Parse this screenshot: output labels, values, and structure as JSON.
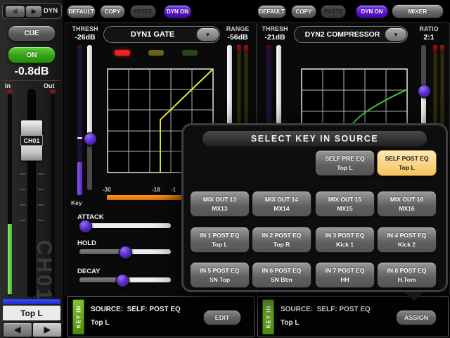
{
  "strip": {
    "nav_label": "DYN",
    "cue": "CUE",
    "on": "ON",
    "level": "-0.8dB",
    "in_label": "In",
    "out_label": "Out",
    "fader_cap": "CH01",
    "watermark": "CH01",
    "channel_name": "Top L"
  },
  "icons": {
    "left_arrow": "◀",
    "right_arrow": "▶",
    "dropdown_arrow": "▼"
  },
  "toolbar1": {
    "default": "DEFAULT",
    "copy": "COPY",
    "paste": "PASTE",
    "dyn_on": "DYN ON"
  },
  "toolbar2": {
    "default": "DEFAULT",
    "copy": "COPY",
    "paste": "PASTE",
    "dyn_on": "DYN ON",
    "mixer": "MIXER"
  },
  "dyn1": {
    "thresh_label": "THRESH",
    "thresh_value": "-26dB",
    "type": "DYN1 GATE",
    "range_label": "RANGE",
    "range_value": "-56dB",
    "key_label": "Key",
    "scale": {
      "t1": "-30",
      "t2": "-18",
      "t3": "-1"
    },
    "attack_label": "ATTACK",
    "hold_label": "HOLD",
    "decay_label": "DECAY",
    "keyin": {
      "tag": "KEY IN",
      "source": "SOURCE:  SELF: POST EQ",
      "name": "Top L",
      "action": "EDIT"
    }
  },
  "dyn2": {
    "thresh_label": "THRESH",
    "thresh_value": "-21dB",
    "type": "DYN2 COMPRESSOR",
    "ratio_label": "RATIO",
    "ratio_value": "2:1",
    "keyin": {
      "tag": "KEY IN",
      "source": "SOURCE:  SELF: POST EQ",
      "name": "Top L",
      "action": "ASSIGN"
    }
  },
  "popup": {
    "title": "SELECT KEY IN SOURCE",
    "buttons": [
      {
        "line1": "SELF PRE EQ",
        "line2": "Top L",
        "selected": false
      },
      {
        "line1": "SELF POST EQ",
        "line2": "Top L",
        "selected": true
      },
      {
        "line1": "MIX OUT 13",
        "line2": "MX13",
        "selected": false
      },
      {
        "line1": "MIX OUT 14",
        "line2": "MX14",
        "selected": false
      },
      {
        "line1": "MIX OUT 15",
        "line2": "MX15",
        "selected": false
      },
      {
        "line1": "MIX OUT 16",
        "line2": "MX16",
        "selected": false
      },
      {
        "line1": "IN 1 POST EQ",
        "line2": "Top L",
        "selected": false
      },
      {
        "line1": "IN 2 POST EQ",
        "line2": "Top R",
        "selected": false
      },
      {
        "line1": "IN 3 POST EQ",
        "line2": "Kick 1",
        "selected": false
      },
      {
        "line1": "IN 4 POST EQ",
        "line2": "Kick 2",
        "selected": false
      },
      {
        "line1": "IN 5 POST EQ",
        "line2": "SN Top",
        "selected": false
      },
      {
        "line1": "IN 6 POST EQ",
        "line2": "SN Btm",
        "selected": false
      },
      {
        "line1": "IN 7 POST EQ",
        "line2": "HH",
        "selected": false
      },
      {
        "line1": "IN 8 POST EQ",
        "line2": "H.Tom",
        "selected": false
      }
    ]
  },
  "colors": {
    "accent_purple": "#5a17d2",
    "selected_orange": "#f6c25e",
    "on_green": "#33a115",
    "keyin_green": "#5c9a1c",
    "meter_orange": "#e87f00",
    "strip_blue": "#2636e6",
    "gate_curve_yellow": "#e8e838",
    "comp_curve_green": "#44cc44"
  }
}
